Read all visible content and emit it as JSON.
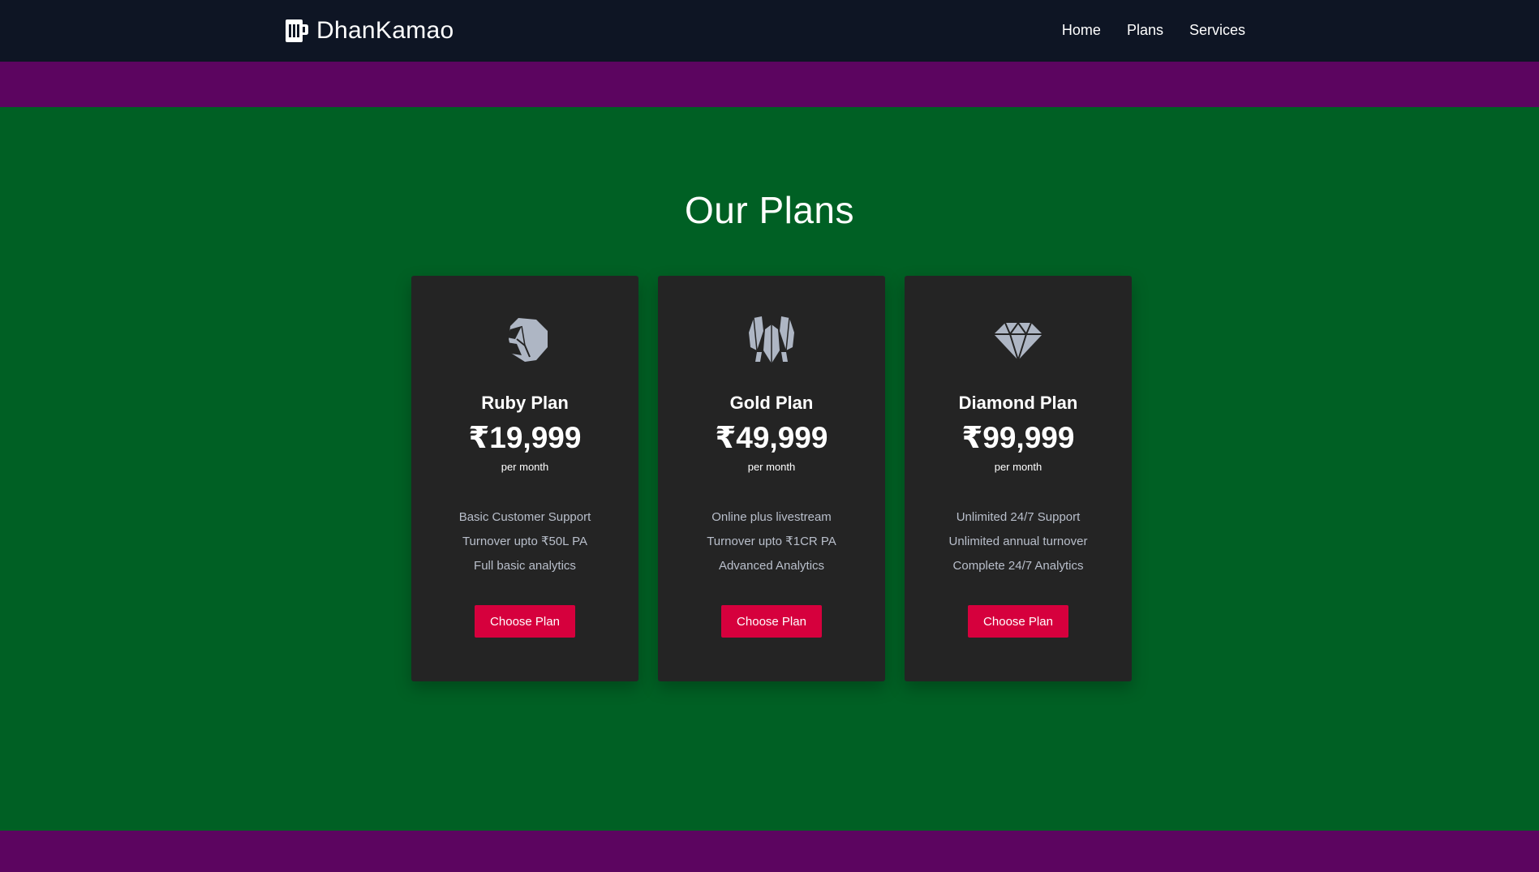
{
  "nav": {
    "brand": "DhanKamao",
    "brand_icon": "mug-icon",
    "links": [
      "Home",
      "Plans",
      "Services"
    ]
  },
  "plans_section": {
    "title": "Our Plans",
    "plans": [
      {
        "icon": "ruby-gem-icon",
        "name": "Ruby Plan",
        "price": "₹19,999",
        "period": "per month",
        "features": [
          "Basic Customer Support",
          "Turnover upto ₹50L PA",
          "Full basic analytics"
        ],
        "button": "Choose Plan"
      },
      {
        "icon": "gold-nuggets-icon",
        "name": "Gold Plan",
        "price": "₹49,999",
        "period": "per month",
        "features": [
          "Online plus livestream",
          "Turnover upto ₹1CR PA",
          "Advanced Analytics"
        ],
        "button": "Choose Plan"
      },
      {
        "icon": "diamond-icon",
        "name": "Diamond Plan",
        "price": "₹99,999",
        "period": "per month",
        "features": [
          "Unlimited 24/7 Support",
          "Unlimited annual turnover",
          "Complete 24/7 Analytics"
        ],
        "button": "Choose Plan"
      }
    ]
  },
  "colors": {
    "navbar_bg": "#0e1524",
    "band_purple": "#5c0560",
    "section_green": "#006024",
    "card_bg": "#242424",
    "button_red": "#d6003d",
    "icon_grey": "#aeb6c4",
    "feature_text": "#b9bfcb"
  }
}
